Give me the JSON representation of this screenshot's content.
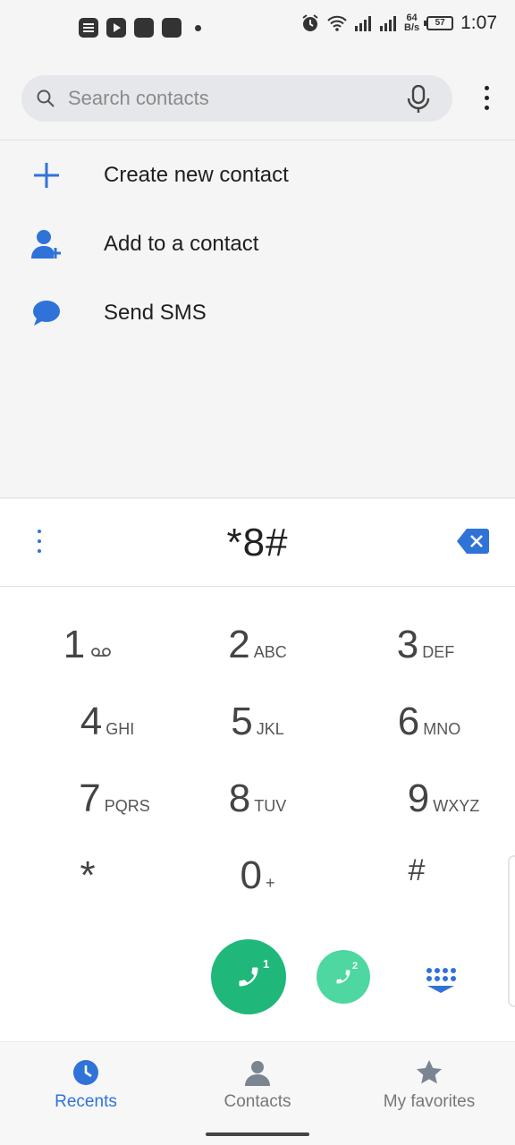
{
  "status_bar": {
    "network_speed_value": "64",
    "network_speed_unit": "B/s",
    "battery": "57",
    "time": "1:07"
  },
  "search": {
    "placeholder": "Search contacts"
  },
  "actions": [
    {
      "label": "Create new contact",
      "icon": "plus-icon"
    },
    {
      "label": "Add to a contact",
      "icon": "add-person-icon"
    },
    {
      "label": "Send SMS",
      "icon": "message-icon"
    }
  ],
  "dialer": {
    "number": "*8#"
  },
  "keypad": [
    {
      "digit": "1",
      "letters": ""
    },
    {
      "digit": "2",
      "letters": "ABC"
    },
    {
      "digit": "3",
      "letters": "DEF"
    },
    {
      "digit": "4",
      "letters": "GHI"
    },
    {
      "digit": "5",
      "letters": "JKL"
    },
    {
      "digit": "6",
      "letters": "MNO"
    },
    {
      "digit": "7",
      "letters": "PQRS"
    },
    {
      "digit": "8",
      "letters": "TUV"
    },
    {
      "digit": "9",
      "letters": "WXYZ"
    },
    {
      "digit": "*",
      "letters": ""
    },
    {
      "digit": "0",
      "letters": "+"
    },
    {
      "digit": "#",
      "letters": ""
    }
  ],
  "call_buttons": {
    "sim1": "1",
    "sim2": "2"
  },
  "bottom_nav": {
    "recents": "Recents",
    "contacts": "Contacts",
    "favorites": "My favorites"
  },
  "colors": {
    "accent": "#2f73d9",
    "call_primary": "#1fb87a",
    "call_secondary": "#4ed7a0"
  }
}
